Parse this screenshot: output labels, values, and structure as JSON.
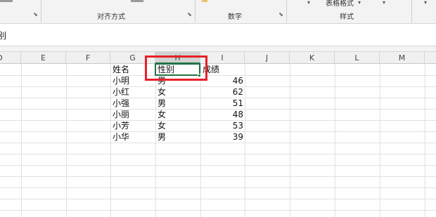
{
  "ribbon": {
    "groups": [
      {
        "label": "对齐方式"
      },
      {
        "label": "数字"
      },
      {
        "label": "样式"
      }
    ],
    "table_format": "表格格式",
    "launcher_glyph": "⬊",
    "caret_glyph": "▾"
  },
  "formula_bar": {
    "content": "别"
  },
  "columns": [
    "D",
    "E",
    "F",
    "G",
    "H",
    "I",
    "J",
    "K",
    "L",
    "M"
  ],
  "selected_column": "H",
  "table": {
    "headers": [
      "姓名",
      "性别",
      "成绩"
    ],
    "rows": [
      {
        "name": "小明",
        "gender": "男",
        "score": "46"
      },
      {
        "name": "小红",
        "gender": "女",
        "score": "62"
      },
      {
        "name": "小强",
        "gender": "男",
        "score": "51"
      },
      {
        "name": "小丽",
        "gender": "女",
        "score": "48"
      },
      {
        "name": "小芳",
        "gender": "女",
        "score": "53"
      },
      {
        "name": "小华",
        "gender": "男",
        "score": "39"
      }
    ]
  },
  "colors": {
    "selection": "#217346",
    "highlight": "#e8202a"
  }
}
